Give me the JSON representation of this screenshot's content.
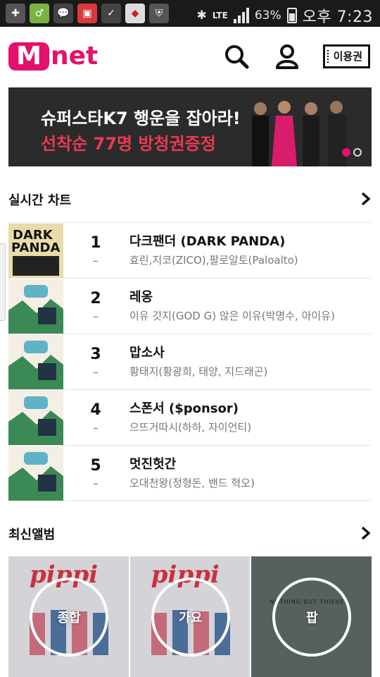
{
  "status_bar": {
    "network": "LTE",
    "battery": "63%",
    "time": "오후 7:23"
  },
  "header": {
    "logo_m": "M",
    "logo_text": "net",
    "ticket_label": "이용권"
  },
  "banner": {
    "title": "슈퍼스타K7 행운을 잡아라!",
    "subtitle": "선착순 77명 방청권증정"
  },
  "realtime_chart": {
    "title": "실시간 차트",
    "rows": [
      {
        "rank": "1",
        "change": "–",
        "title": "다크팬더 (DARK PANDA)",
        "artist": "효린,지코(ZICO),팔로알토(Paloalto)"
      },
      {
        "rank": "2",
        "change": "–",
        "title": "레옹",
        "artist": "이유 갓지(GOD G) 않은 이유(박명수, 아이유)"
      },
      {
        "rank": "3",
        "change": "–",
        "title": "맙소사",
        "artist": "황태지(황광희, 태양, 지드래곤)"
      },
      {
        "rank": "4",
        "change": "–",
        "title": "스폰서 ($ponsor)",
        "artist": "으뜨거따시(하하, 자이언티)"
      },
      {
        "rank": "5",
        "change": "–",
        "title": "멋진헛간",
        "artist": "오대천왕(정형돈, 밴드 혁오)"
      }
    ]
  },
  "new_albums": {
    "title": "최신앨범",
    "items": [
      {
        "label": "종합",
        "cover_text": "pippi"
      },
      {
        "label": "가요",
        "cover_text": "pippi"
      },
      {
        "label": "팝",
        "cover_text": "NOTHING BUT THIEVES"
      }
    ]
  },
  "colors": {
    "brand": "#e4106e",
    "banner_accent": "#e93a52"
  }
}
